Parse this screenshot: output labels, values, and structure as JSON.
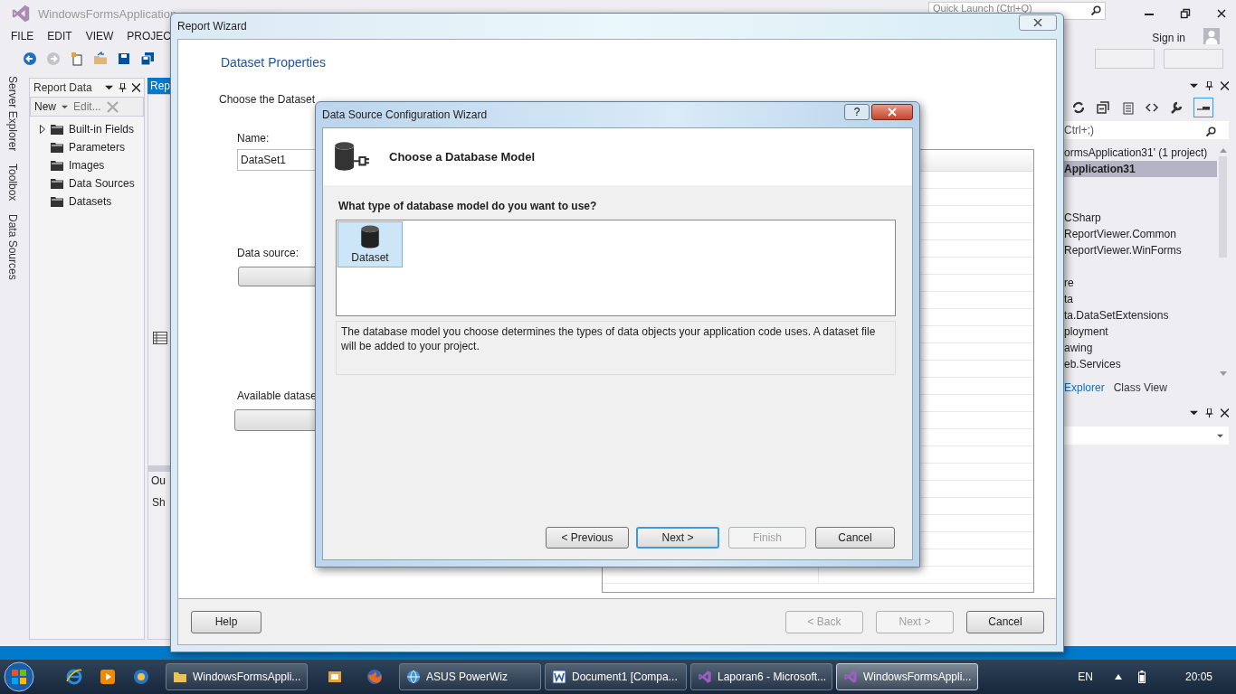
{
  "ide": {
    "title": "WindowsFormsApplication",
    "quick_launch": {
      "placeholder": "Quick Launch (Ctrl+Q)"
    },
    "menu": [
      "FILE",
      "EDIT",
      "VIEW",
      "PROJEC"
    ],
    "sign_in": "Sign in",
    "side_tabs": [
      "Server Explorer",
      "Toolbox",
      "Data Sources"
    ],
    "report_data": {
      "title": "Report Data",
      "new": "New",
      "edit": "Edit...",
      "items": [
        {
          "label": "Built-in Fields",
          "kind": "expandable"
        },
        {
          "label": "Parameters",
          "kind": "leaf"
        },
        {
          "label": "Images",
          "kind": "leaf"
        },
        {
          "label": "Data Sources",
          "kind": "leaf"
        },
        {
          "label": "Datasets",
          "kind": "leaf"
        }
      ]
    },
    "document": {
      "tab": "Rep",
      "output_title": "Ou",
      "output_show": "Sh"
    },
    "solution_explorer": {
      "search_placeholder": "Ctrl+;)",
      "items": [
        {
          "label": "ormsApplication31' (1 project)",
          "selected": false,
          "kind": "solution"
        },
        {
          "label": "Application31",
          "selected": true,
          "kind": "project"
        },
        {
          "kind": "blank"
        },
        {
          "kind": "blank"
        },
        {
          "label": "CSharp",
          "selected": false,
          "kind": "reference"
        },
        {
          "label": "ReportViewer.Common",
          "selected": false,
          "kind": "reference"
        },
        {
          "label": "ReportViewer.WinForms",
          "selected": false,
          "kind": "reference"
        },
        {
          "kind": "blank"
        },
        {
          "label": "re",
          "selected": false,
          "kind": "reference"
        },
        {
          "label": "ta",
          "selected": false,
          "kind": "reference"
        },
        {
          "label": "ta.DataSetExtensions",
          "selected": false,
          "kind": "reference"
        },
        {
          "label": "ployment",
          "selected": false,
          "kind": "reference"
        },
        {
          "label": "awing",
          "selected": false,
          "kind": "reference"
        },
        {
          "label": "eb.Services",
          "selected": false,
          "kind": "reference"
        }
      ],
      "tabs": [
        {
          "label": "Explorer",
          "selected": true
        },
        {
          "label": "Class View",
          "selected": false
        }
      ]
    }
  },
  "report_wizard": {
    "title": "Report Wizard",
    "heading": "Dataset Properties",
    "subheading": "Choose the Dataset",
    "name_label": "Name:",
    "name_value": "DataSet1",
    "data_source_label": "Data source:",
    "available_label": "Available datase",
    "help": "Help",
    "buttons": [
      {
        "label": "< Back",
        "disabled": true
      },
      {
        "label": "Next >",
        "disabled": true
      },
      {
        "label": "Cancel",
        "disabled": false
      }
    ]
  },
  "config_wizard": {
    "title": "Data Source Configuration Wizard",
    "help": "?",
    "heading": "Choose a Database Model",
    "question": "What type of database model do you want to use?",
    "models": [
      {
        "label": "Dataset",
        "selected": true
      }
    ],
    "description": "The database model you choose determines the types of data objects your application code uses. A dataset file will be added to your project.",
    "buttons": [
      {
        "label": "< Previous",
        "disabled": false,
        "default": false
      },
      {
        "label": "Next >",
        "disabled": false,
        "default": true
      },
      {
        "label": "Finish",
        "disabled": true,
        "default": false
      },
      {
        "label": "Cancel",
        "disabled": false,
        "default": false
      }
    ]
  },
  "taskbar": {
    "tasks": [
      {
        "label": "WindowsFormsAppli...",
        "kind": "folder",
        "selected": false
      },
      {
        "label": "ASUS PowerWiz",
        "kind": "globe",
        "selected": false
      },
      {
        "label": "Document1 [Compa...",
        "kind": "word",
        "selected": false
      },
      {
        "label": "Laporan6 - Microsoft...",
        "kind": "vs",
        "selected": false
      },
      {
        "label": "WindowsFormsAppli...",
        "kind": "vs",
        "selected": true
      }
    ],
    "language": "EN",
    "clock": "20:05"
  }
}
